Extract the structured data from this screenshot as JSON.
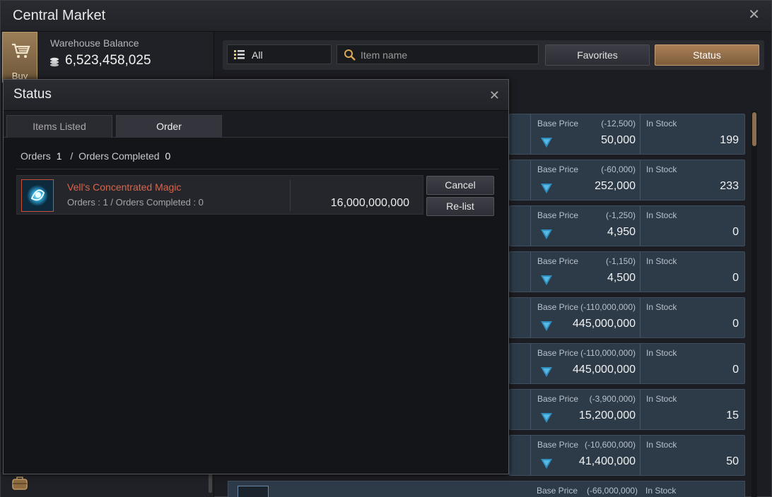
{
  "window": {
    "title": "Central Market",
    "close_glyph": "✕"
  },
  "left": {
    "buy_label": "Buy",
    "balance_label": "Warehouse Balance",
    "balance_value": "6,523,458,025"
  },
  "filter": {
    "category_selected": "All",
    "search_placeholder": "Item name",
    "favorites_label": "Favorites",
    "status_label": "Status"
  },
  "market_rows": [
    {
      "base_price_label": "Base Price",
      "change": "(-12,500)",
      "price": "50,000",
      "in_stock_label": "In Stock",
      "stock": "199"
    },
    {
      "base_price_label": "Base Price",
      "change": "(-60,000)",
      "price": "252,000",
      "in_stock_label": "In Stock",
      "stock": "233"
    },
    {
      "base_price_label": "Base Price",
      "change": "(-1,250)",
      "price": "4,950",
      "in_stock_label": "In Stock",
      "stock": "0"
    },
    {
      "base_price_label": "Base Price",
      "change": "(-1,150)",
      "price": "4,500",
      "in_stock_label": "In Stock",
      "stock": "0"
    },
    {
      "base_price_label": "Base Price",
      "change": "(-110,000,000)",
      "price": "445,000,000",
      "in_stock_label": "In Stock",
      "stock": "0"
    },
    {
      "base_price_label": "Base Price",
      "change": "(-110,000,000)",
      "price": "445,000,000",
      "in_stock_label": "In Stock",
      "stock": "0"
    },
    {
      "base_price_label": "Base Price",
      "change": "(-3,900,000)",
      "price": "15,200,000",
      "in_stock_label": "In Stock",
      "stock": "15"
    },
    {
      "base_price_label": "Base Price",
      "change": "(-10,600,000)",
      "price": "41,400,000",
      "in_stock_label": "In Stock",
      "stock": "50"
    }
  ],
  "partial_row": {
    "base_price_label": "Base Price",
    "change": "(-66,000,000)",
    "in_stock_label": "In Stock"
  },
  "status_dialog": {
    "title": "Status",
    "close_glyph": "✕",
    "tabs": [
      "Items Listed",
      "Order"
    ],
    "active_tab": "Order",
    "summary": {
      "orders_label": "Orders",
      "orders_value": "1",
      "separator": "/",
      "completed_label": "Orders Completed",
      "completed_value": "0"
    },
    "order": {
      "name": "Vell's Concentrated Magic",
      "detail": "Orders : 1 / Orders Completed : 0",
      "price": "16,000,000,000",
      "cancel_label": "Cancel",
      "relist_label": "Re-list"
    }
  },
  "colors": {
    "accent": "#a98058",
    "item_name": "#d8654c",
    "row_bg": "#2d3a48",
    "down_arrow": "#2f8fc0"
  }
}
